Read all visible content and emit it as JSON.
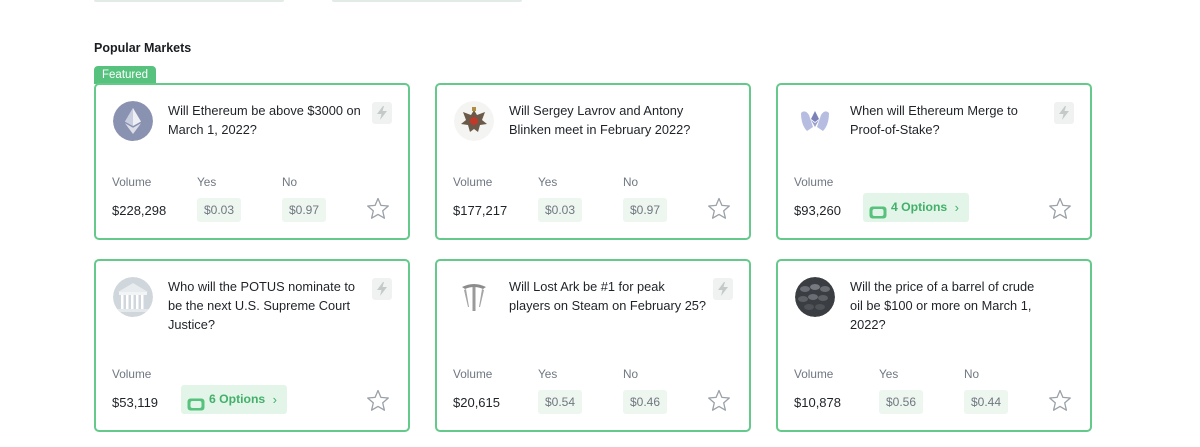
{
  "section_title": "Popular Markets",
  "featured_tag": "Featured",
  "labels": {
    "volume": "Volume",
    "yes": "Yes",
    "no": "No"
  },
  "colors": {
    "accent": "#56c27d",
    "card_border": "#64c98a",
    "price_bg": "#eef6f0",
    "options_bg": "#e3f5e8"
  },
  "markets": [
    {
      "question": "Will Ethereum be above $3000 on March 1, 2022?",
      "icon": "ethereum-icon",
      "volume": "$228,298",
      "yes": "$0.03",
      "no": "$0.97"
    },
    {
      "question": "Will Sergey Lavrov and Antony Blinken meet in February 2022?",
      "icon": "russian-eagle-icon",
      "volume": "$177,217",
      "yes": "$0.03",
      "no": "$0.97"
    },
    {
      "question": "When will Ethereum Merge to Proof-of-Stake?",
      "icon": "merge-hands-icon",
      "volume": "$93,260",
      "options": "4 Options"
    },
    {
      "question": "Who will the POTUS nominate to be the next U.S. Supreme Court Justice?",
      "icon": "supreme-court-icon",
      "volume": "$53,119",
      "options": "6 Options"
    },
    {
      "question": "Will Lost Ark be #1 for peak players on Steam on February 25?",
      "icon": "lost-ark-icon",
      "volume": "$20,615",
      "yes": "$0.54",
      "no": "$0.46"
    },
    {
      "question": "Will the price of a barrel of crude oil be $100 or more on March 1, 2022?",
      "icon": "oil-barrels-icon",
      "volume": "$10,878",
      "yes": "$0.56",
      "no": "$0.44"
    }
  ]
}
